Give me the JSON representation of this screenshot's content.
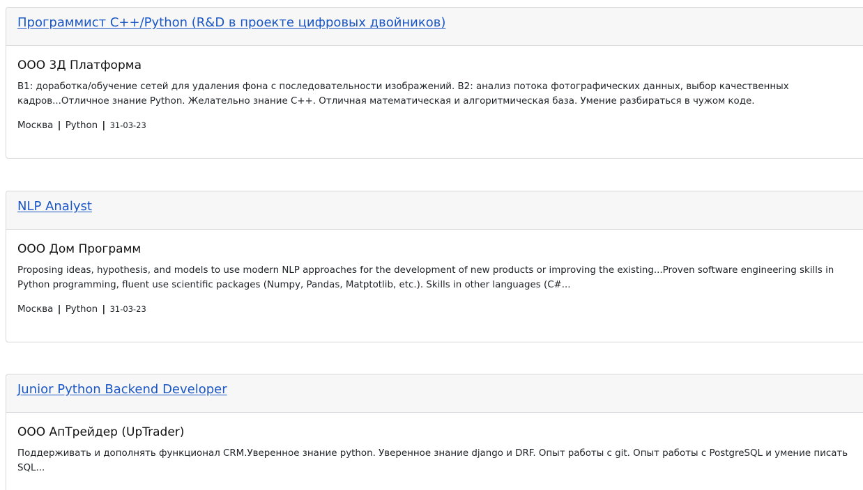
{
  "vacancies": [
    {
      "title": "Программист C++/Python (R&D в проекте цифровых двойников)",
      "company": "ООО 3Д Платформа",
      "description": "В1: доработка/обучение сетей для удаления фона с последовательности изображений. В2: анализ потока фотографических данных, выбор качественных кадров...Отличное знание Python. Желательно знание C++. Отличная математическая и алгоритмическая база. Умение разбираться в чужом коде.",
      "city": "Москва",
      "tag": "Python",
      "separator": "|",
      "date": "31-03-23"
    },
    {
      "title": "NLP Analyst",
      "company": "ООО Дом Программ",
      "description": "Proposing ideas, hypothesis, and models to use modern NLP approaches for the development of new products or improving the existing...Proven software engineering skills in Python programming, fluent use scientific packages (Numpy, Pandas, Matptotlib, etc.). Skills in other languages (C#...",
      "city": "Москва",
      "tag": "Python",
      "separator": "|",
      "date": "31-03-23"
    },
    {
      "title": "Junior Python Backend Developer",
      "company": "ООО АпТрейдер (UpTrader)",
      "description": "Поддерживать и дополнять функционал CRM.Уверенное знание python. Уверенное знание django и DRF. Опыт работы с git. Опыт работы с PostgreSQL и умение писать SQL..."
    }
  ],
  "colors": {
    "link": "#1a56c4",
    "header_bg": "#f7f7f7",
    "border": "#d6d8db"
  }
}
